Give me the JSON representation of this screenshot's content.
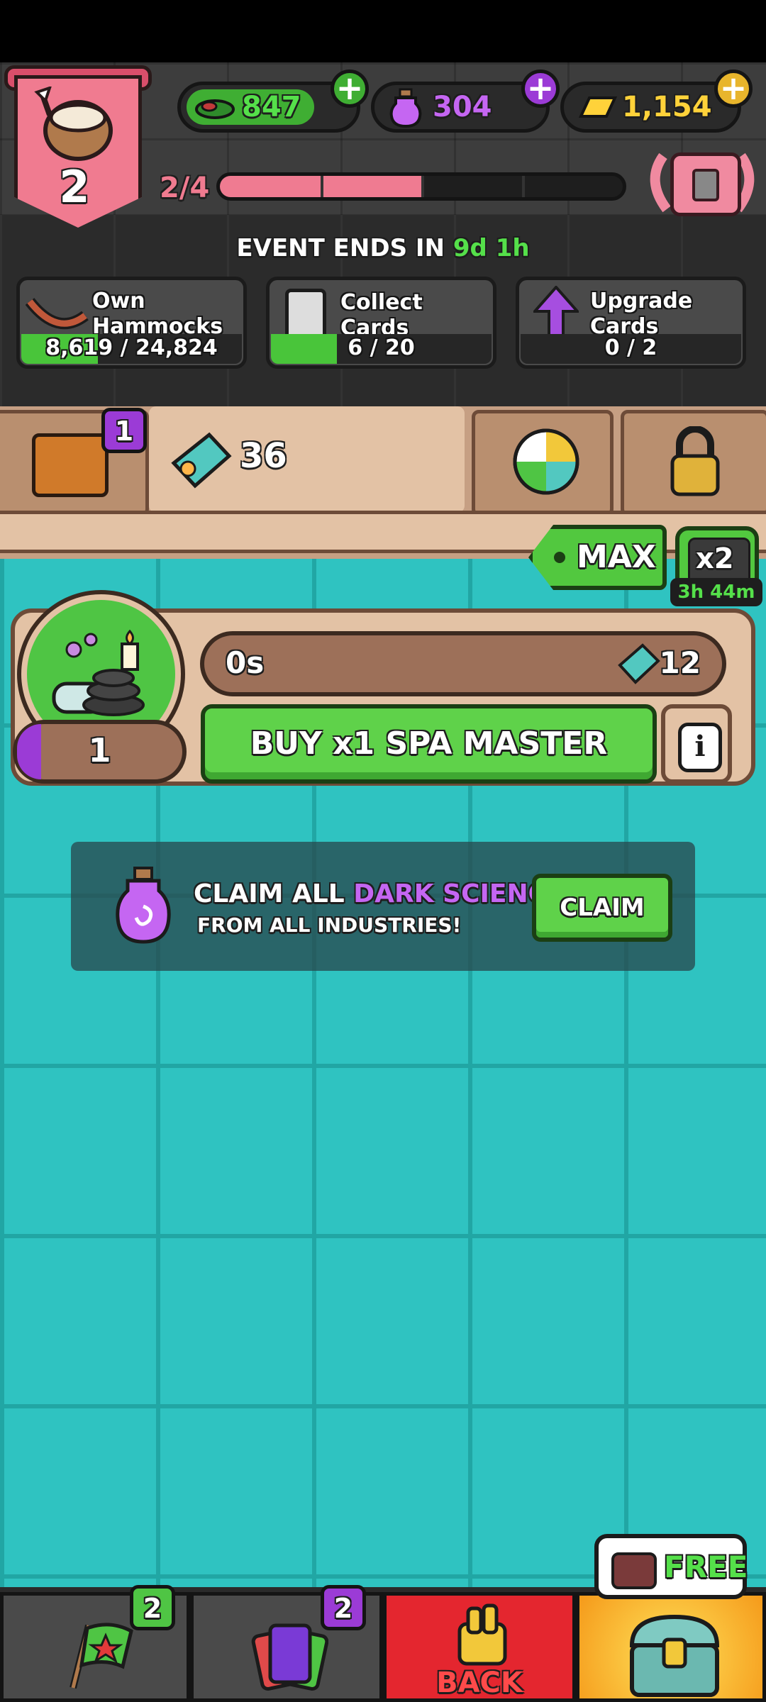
{
  "header": {
    "rank_level": "2",
    "rank_progress_text": "2/4",
    "rank_progress": 0.5,
    "currencies": [
      {
        "name": "cash",
        "value": "847",
        "color": "#55e04a"
      },
      {
        "name": "dark-science",
        "value": "304",
        "color": "#c566f2"
      },
      {
        "name": "gold",
        "value": "1,154",
        "color": "#ffd23a"
      }
    ]
  },
  "event": {
    "ends_prefix": "EVENT ENDS IN ",
    "days": "9d",
    "hours": "1h",
    "goals": [
      {
        "label_line1": "Own",
        "label_line2": "Hammocks",
        "progress_text": "8,619 / 24,824",
        "progress": 0.347,
        "icon": "hammock-icon"
      },
      {
        "label_line1": "Collect Cards",
        "label_line2": "",
        "progress_text": "6 / 20",
        "progress": 0.3,
        "icon": "card-icon"
      },
      {
        "label_line1": "Upgrade",
        "label_line2": "Cards",
        "progress_text": "0 / 2",
        "progress": 0,
        "icon": "purple-arrow-up-icon"
      }
    ]
  },
  "tabs": {
    "suitcase_badge": "1",
    "active_count": "36"
  },
  "boost": {
    "max_label": "MAX",
    "multiplier_label": "x2",
    "timer": "3h 44m"
  },
  "industry": {
    "level": "1",
    "timer": "0s",
    "reward": "12",
    "buy_label": "BUY x1 SPA MASTER",
    "info_label": "i"
  },
  "claim": {
    "line1_prefix": "CLAIM ALL ",
    "line1_highlight": "DARK SCIENCE",
    "line2": "FROM ALL INDUSTRIES!",
    "button_label": "CLAIM",
    "highlight_color": "#c566f2"
  },
  "bottom_nav": {
    "missions_badge": "2",
    "cards_badge": "2",
    "back_label": "BACK",
    "free_label": "FREE"
  }
}
